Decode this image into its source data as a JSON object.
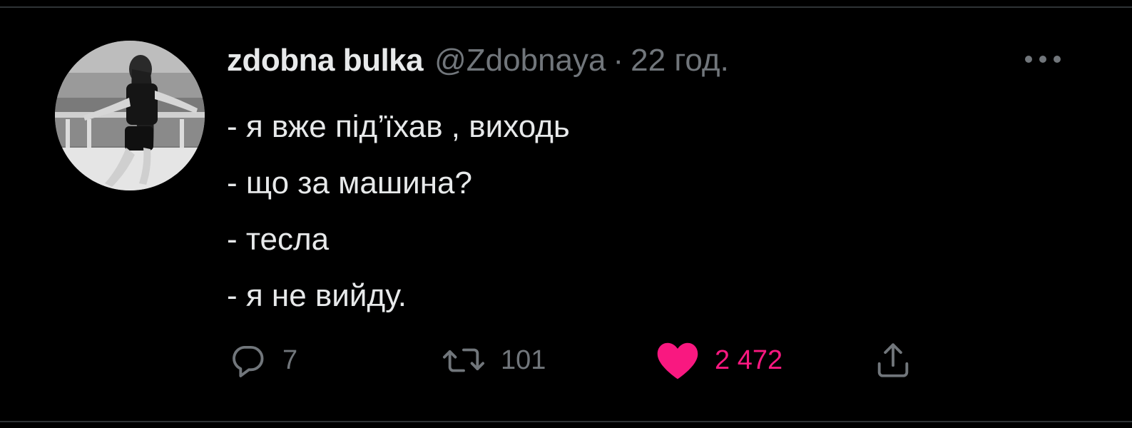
{
  "tweet": {
    "author": {
      "display_name": "zdobna bulka",
      "handle": "@Zdobnaya"
    },
    "separator": "·",
    "timestamp": "22 год.",
    "lines": [
      "- я вже під’їхав , виходь",
      "- що за машина?",
      "- тесла",
      "- я не вийду."
    ],
    "actions": {
      "reply": {
        "icon": "reply-icon",
        "count": "7"
      },
      "retweet": {
        "icon": "retweet-icon",
        "count": "101"
      },
      "like": {
        "icon": "heart-icon",
        "count": "2 472",
        "active": true,
        "color": "#f91880"
      },
      "share": {
        "icon": "share-icon"
      }
    }
  },
  "colors": {
    "background": "#000000",
    "text_primary": "#e7e9ea",
    "text_secondary": "#71767b",
    "like_active": "#f91880"
  }
}
